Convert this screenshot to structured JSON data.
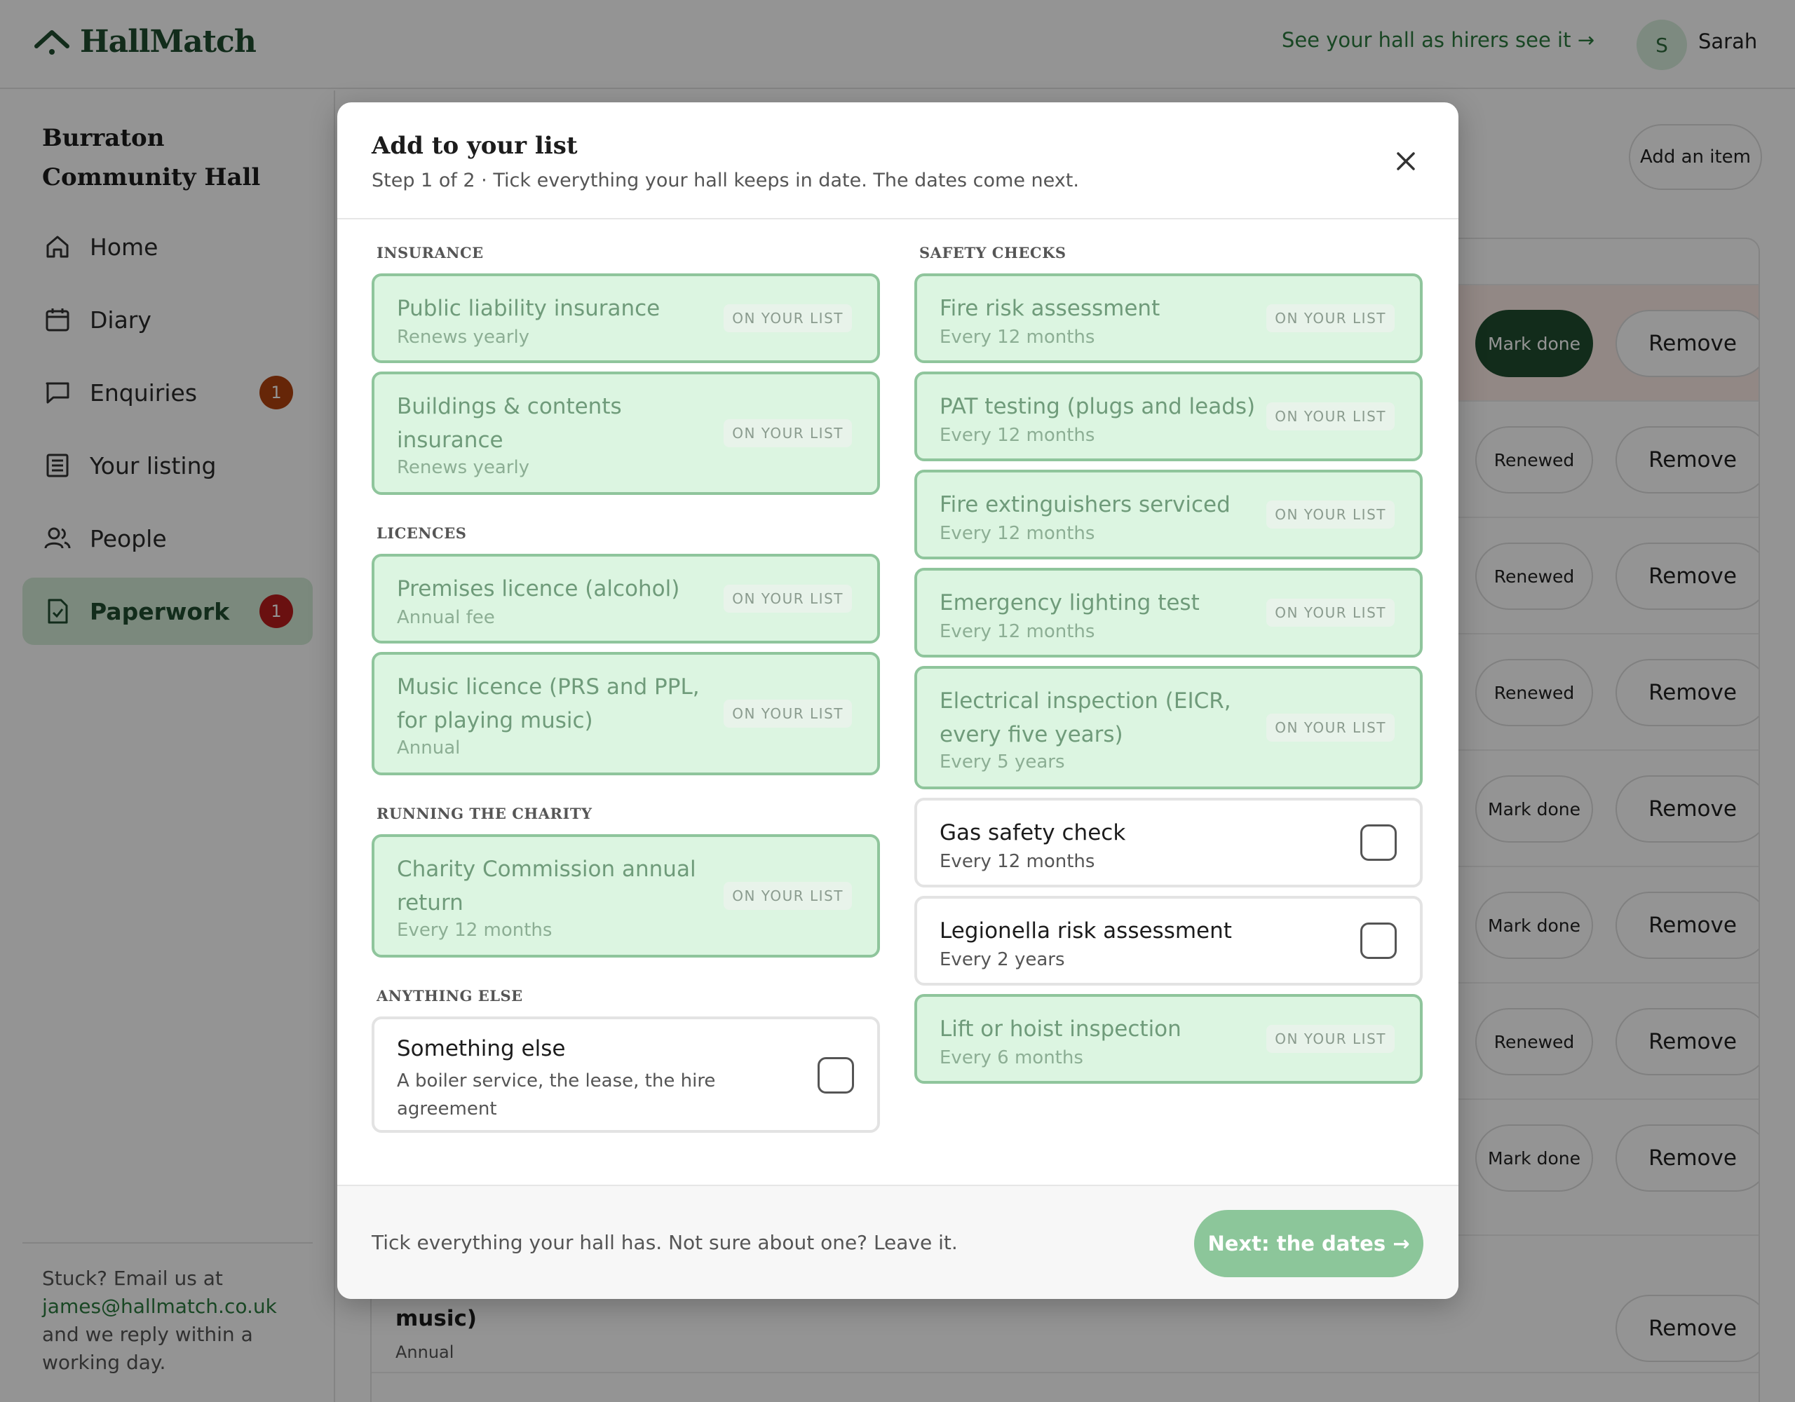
{
  "brand": {
    "name": "HallMatch"
  },
  "header": {
    "preview_link": "See your hall as hirers see it →",
    "avatar_initial": "S",
    "user_name": "Sarah"
  },
  "sidebar": {
    "hall_name": "Burraton Community Hall",
    "items": [
      {
        "label": "Home",
        "icon": "home-icon"
      },
      {
        "label": "Diary",
        "icon": "calendar-icon"
      },
      {
        "label": "Enquiries",
        "icon": "chat-icon",
        "badge": "1"
      },
      {
        "label": "Your listing",
        "icon": "document-icon"
      },
      {
        "label": "People",
        "icon": "people-icon"
      },
      {
        "label": "Paperwork",
        "icon": "file-check-icon",
        "badge": "1",
        "active": true
      }
    ],
    "help": {
      "prefix": "Stuck? Email us at",
      "email": "james@hallmatch.co.uk",
      "suffix": "and we reply within a working day."
    }
  },
  "main": {
    "add_item_label": "Add an item",
    "rows": [
      {
        "action": "Mark done",
        "remove": "Remove"
      },
      {
        "action": "Renewed",
        "remove": "Remove"
      },
      {
        "action": "Renewed",
        "remove": "Remove"
      },
      {
        "action": "Renewed",
        "remove": "Remove"
      },
      {
        "action": "Mark done",
        "remove": "Remove"
      },
      {
        "action": "Mark done",
        "remove": "Remove"
      },
      {
        "action": "Renewed",
        "remove": "Remove"
      },
      {
        "action": "Mark done",
        "remove": "Remove"
      },
      {
        "title": "music)",
        "subtitle": "Annual",
        "remove": "Remove"
      }
    ]
  },
  "modal": {
    "title": "Add to your list",
    "subtitle": "Step 1 of 2 · Tick everything your hall keeps in date. The dates come next.",
    "on_list_tag": "ON YOUR LIST",
    "sections": {
      "insurance": {
        "label": "INSURANCE",
        "items": [
          {
            "name": "Public liability insurance",
            "freq": "Renews yearly",
            "on_list": true
          },
          {
            "name": "Buildings & contents insurance",
            "freq": "Renews yearly",
            "on_list": true
          }
        ]
      },
      "licences": {
        "label": "LICENCES",
        "items": [
          {
            "name": "Premises licence (alcohol)",
            "freq": "Annual fee",
            "on_list": true
          },
          {
            "name": "Music licence (PRS and PPL, for playing music)",
            "freq": "Annual",
            "on_list": true
          }
        ]
      },
      "charity": {
        "label": "RUNNING THE CHARITY",
        "items": [
          {
            "name": "Charity Commission annual return",
            "freq": "Every 12 months",
            "on_list": true
          }
        ]
      },
      "else": {
        "label": "ANYTHING ELSE",
        "items": [
          {
            "name": "Something else",
            "freq": "A boiler service, the lease, the hire agreement",
            "on_list": false,
            "checked": false
          }
        ]
      },
      "safety": {
        "label": "SAFETY CHECKS",
        "items": [
          {
            "name": "Fire risk assessment",
            "freq": "Every 12 months",
            "on_list": true
          },
          {
            "name": "PAT testing (plugs and leads)",
            "freq": "Every 12 months",
            "on_list": true
          },
          {
            "name": "Fire extinguishers serviced",
            "freq": "Every 12 months",
            "on_list": true
          },
          {
            "name": "Emergency lighting test",
            "freq": "Every 12 months",
            "on_list": true
          },
          {
            "name": "Electrical inspection (EICR, every five years)",
            "freq": "Every 5 years",
            "on_list": true
          },
          {
            "name": "Gas safety check",
            "freq": "Every 12 months",
            "on_list": false,
            "checked": false
          },
          {
            "name": "Legionella risk assessment",
            "freq": "Every 2 years",
            "on_list": false,
            "checked": false
          },
          {
            "name": "Lift or hoist inspection",
            "freq": "Every 6 months",
            "on_list": true
          }
        ]
      }
    },
    "footer_text": "Tick everything your hall has. Not sure about one? Leave it.",
    "next_label": "Next: the dates →"
  },
  "colors": {
    "brand_green": "#1f4d2f",
    "accent_green": "#2b7a3e",
    "selected_bg": "#dcf5e1",
    "selected_border": "#8fc59c",
    "badge_orange": "#b0420f",
    "badge_red": "#b71c1c",
    "next_button": "#8cc69a"
  }
}
